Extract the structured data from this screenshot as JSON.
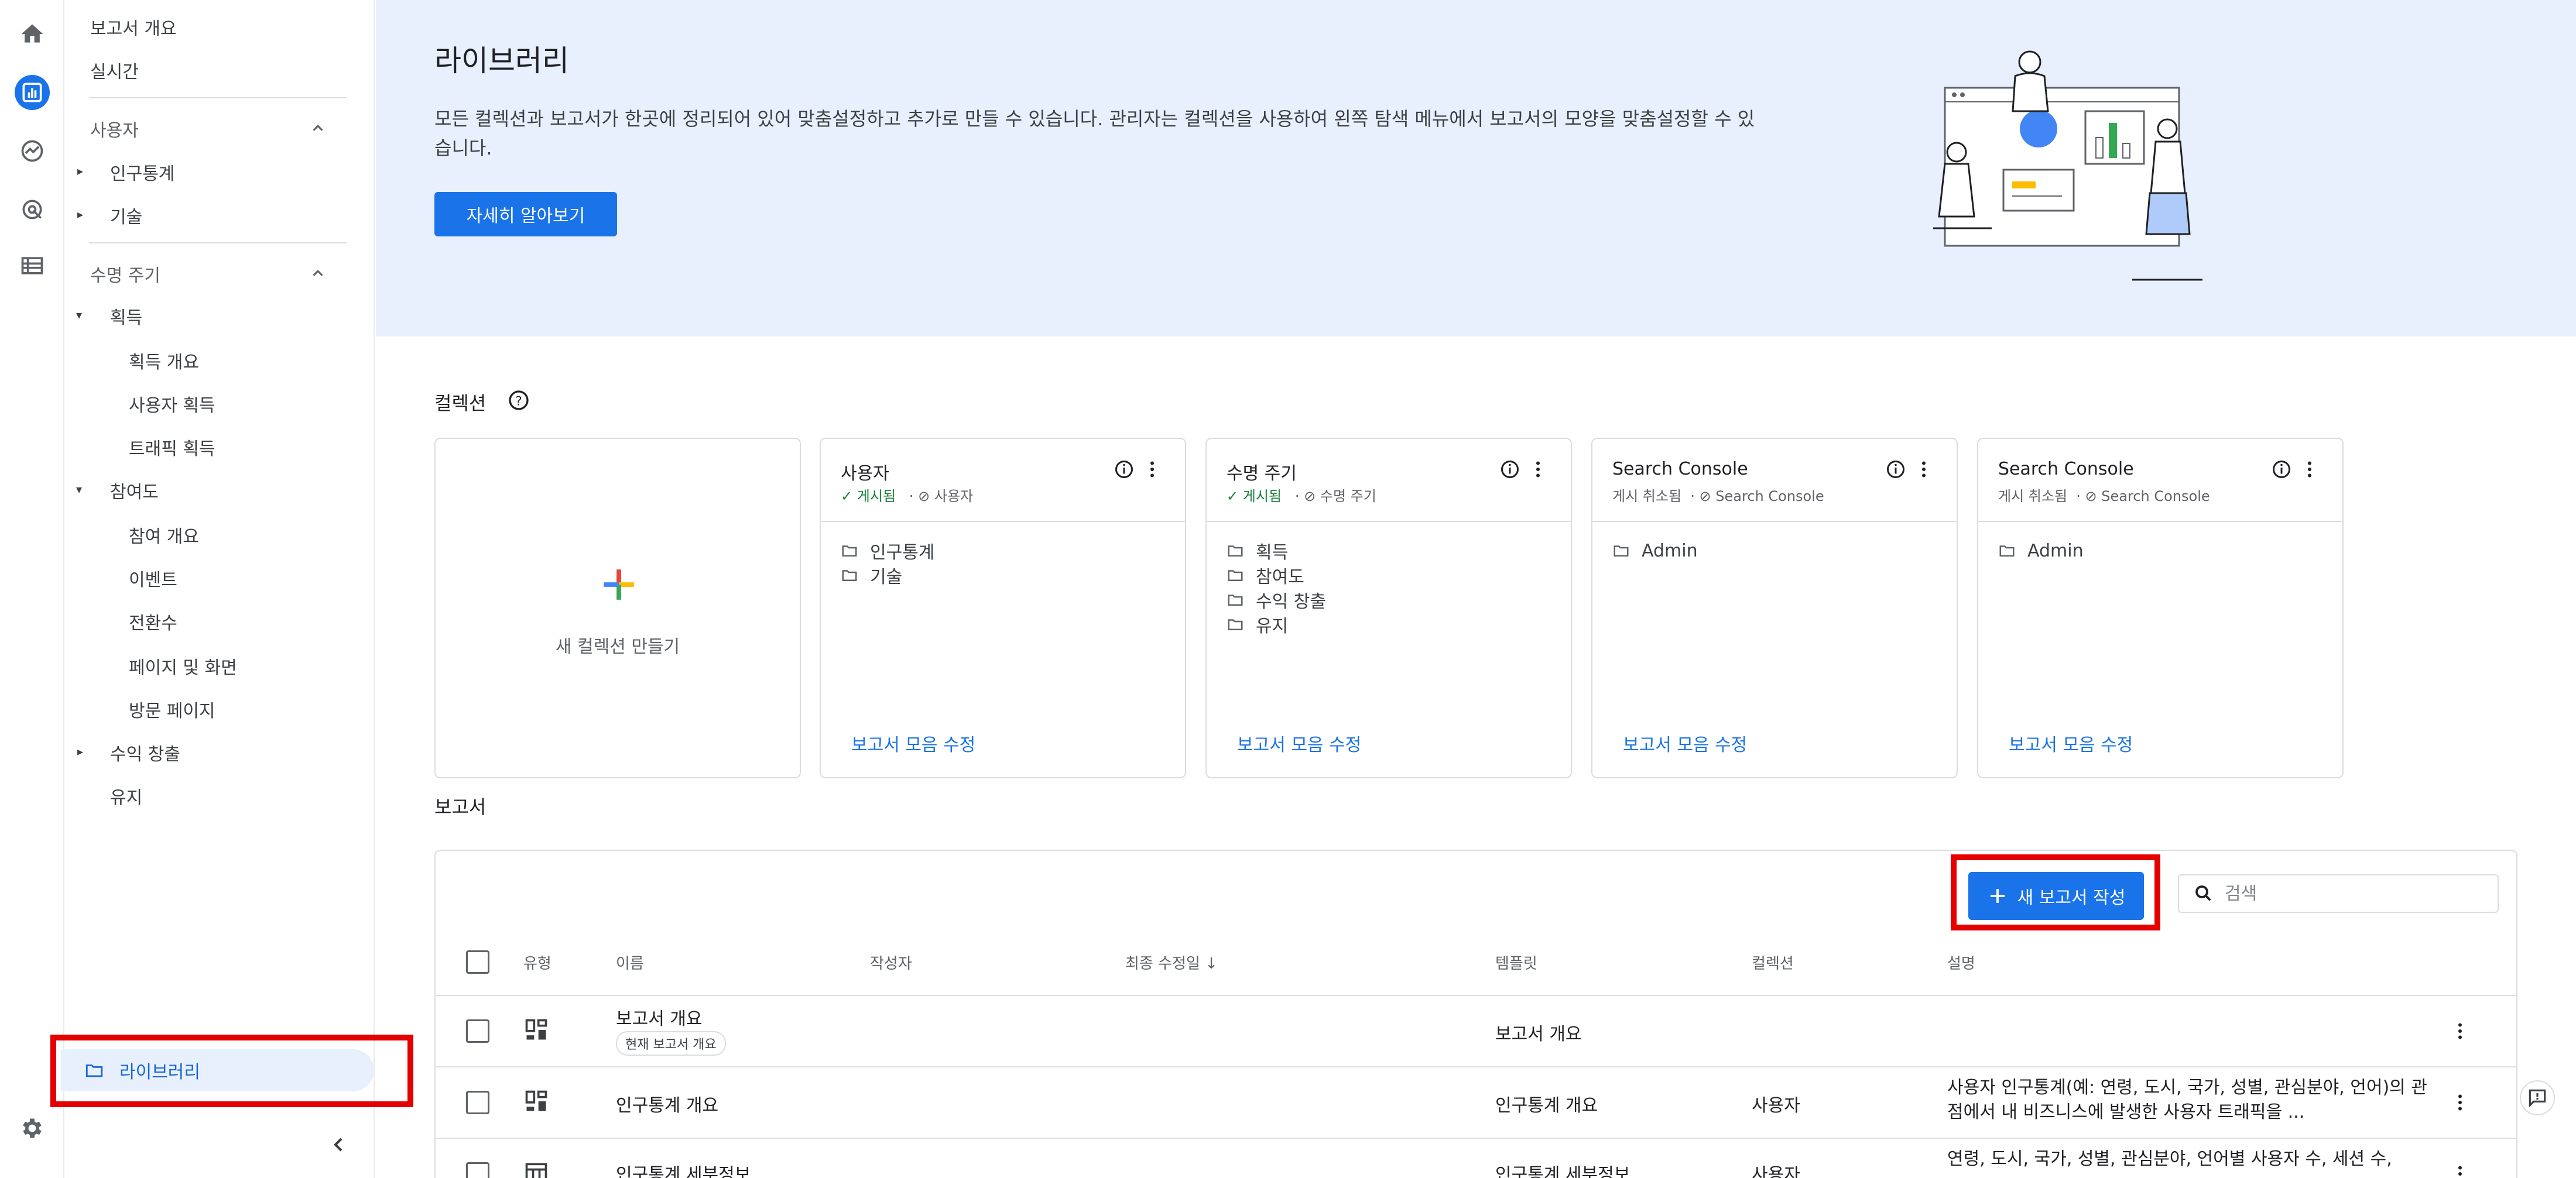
{
  "sidebar": {
    "items": {
      "report_overview": "보고서 개요",
      "realtime": "실시간",
      "user_section": "사용자",
      "demographics": "인구통계",
      "tech": "기술",
      "lifecycle_section": "수명 주기",
      "acquisition": "획득",
      "acquisition_overview": "획득 개요",
      "user_acquisition": "사용자 획득",
      "traffic_acquisition": "트래픽 획득",
      "engagement": "참여도",
      "engagement_overview": "참여 개요",
      "events": "이벤트",
      "conversions": "전환수",
      "pages_screens": "페이지 및 화면",
      "landing_page": "방문 페이지",
      "monetization": "수익 창출",
      "retention": "유지",
      "library": "라이브러리"
    }
  },
  "hero": {
    "title": "라이브러리",
    "desc": "모든 컬렉션과 보고서가 한곳에 정리되어 있어 맞춤설정하고 추가로 만들 수 있습니다. 관리자는 컬렉션을 사용하여 왼쪽 탐색 메뉴에서 보고서의 모양을 맞춤설정할 수 있습니다.",
    "learn_more": "자세히 알아보기"
  },
  "collections": {
    "title": "컬렉션",
    "new_label": "새 컬렉션 만들기",
    "edit_label": "보고서 모음 수정",
    "cards": [
      {
        "title": "사용자",
        "status": "게시됨",
        "template": "사용자",
        "folders": [
          "인구통계",
          "기술"
        ]
      },
      {
        "title": "수명 주기",
        "status": "게시됨",
        "template": "수명 주기",
        "folders": [
          "획득",
          "참여도",
          "수익 창출",
          "유지"
        ]
      },
      {
        "title": "Search Console",
        "status": "게시 취소됨",
        "template": "Search Console",
        "folders": [
          "Admin"
        ]
      },
      {
        "title": "Search Console",
        "status": "게시 취소됨",
        "template": "Search Console",
        "folders": [
          "Admin"
        ]
      }
    ]
  },
  "reports": {
    "title": "보고서",
    "new_report": "새 보고서 작성",
    "search_placeholder": "검색",
    "headers": {
      "type": "유형",
      "name": "이름",
      "author": "작성자",
      "modified": "최종 수정일",
      "template": "템플릿",
      "collection": "컬렉션",
      "description": "설명"
    },
    "rows": [
      {
        "name": "보고서 개요",
        "chip": "현재 보고서 개요",
        "template": "보고서 개요",
        "collection": "",
        "desc": ""
      },
      {
        "name": "인구통계 개요",
        "template": "인구통계 개요",
        "collection": "사용자",
        "desc": "사용자 인구통계(예: 연령, 도시, 국가, 성별, 관심분야, 언어)의 관점에서 내 비즈니스에 발생한 사용자 트래픽을 ..."
      },
      {
        "name": "인구통계 세부정보",
        "template": "인구통계 세부정보",
        "collection": "사용자",
        "desc": "연령, 도시, 국가, 성별, 관심분야, 언어별 사용자 수, 세션 수,"
      }
    ]
  },
  "colors": {
    "accent": "#1a73e8",
    "highlight": "#e50000",
    "hero_bg": "#e8f0fe"
  }
}
